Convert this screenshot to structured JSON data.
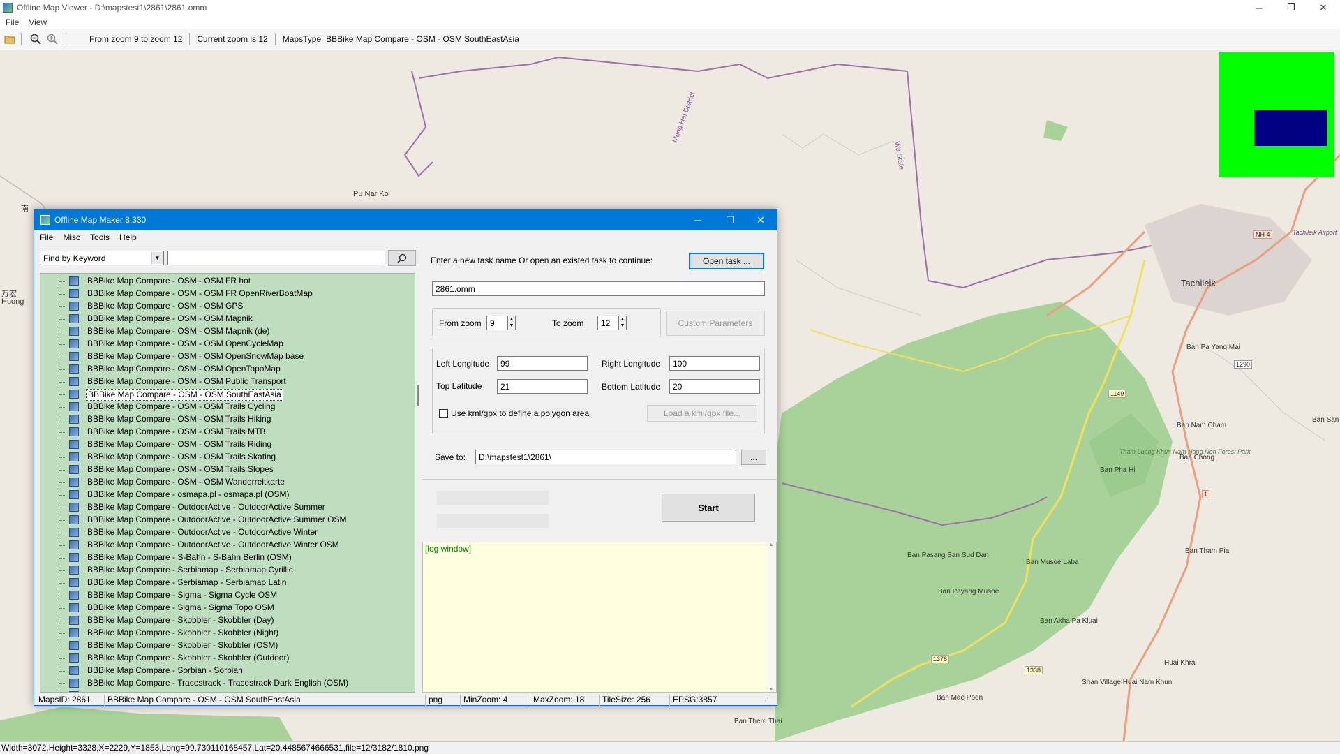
{
  "window": {
    "title": "Offline Map Viewer - D:\\mapstest1\\2861\\2861.omm",
    "controls": [
      "─",
      "❐",
      "✕"
    ]
  },
  "menubar": [
    "File",
    "View"
  ],
  "toolbar": {
    "zoom_range": "From zoom 9 to zoom 12",
    "current_zoom": "Current zoom is 12",
    "maps_type": "MapsType=BBBike Map Compare - OSM - OSM SouthEastAsia"
  },
  "map": {
    "labels": [
      "Pu Nar Ko",
      "南",
      "万宏",
      "Huong",
      "Tachileik",
      "Ban Pa Yang Mai",
      "Ban Nam Cham",
      "Ban San",
      "Ban Pha Hi",
      "Ban Chong",
      "Ban Pasang San Sud Dan",
      "Ban Musoe Laba",
      "Ban Tham Pia",
      "Ban Payang Musoe",
      "Ban Akha Pa Kluai",
      "Ban Mae Poen",
      "Huai Khrai",
      "Shan Village Huai Nam Khun",
      "Ban Therd Thai",
      "Mong Hai District",
      "Wa State",
      "Tham Luang Khun Nam Nang Non Forest Park",
      "Tachileik Airport",
      "NH 4",
      "1290",
      "1149",
      "1378",
      "1338",
      "1"
    ]
  },
  "statusbar": "Width=3072,Height=3328,X=2229,Y=1853,Long=99.730110168457,Lat=20.4485674666531,file=12/3182/1810.png",
  "dialog": {
    "title": "Offline Map Maker 8.330",
    "menu": [
      "File",
      "Misc",
      "Tools",
      "Help"
    ],
    "search": {
      "mode": "Find by Keyword",
      "keyword": ""
    },
    "tree_items": [
      "BBBike Map Compare - OSM - OSM FR hot",
      "BBBike Map Compare - OSM - OSM FR OpenRiverBoatMap",
      "BBBike Map Compare - OSM - OSM GPS",
      "BBBike Map Compare - OSM - OSM Mapnik",
      "BBBike Map Compare - OSM - OSM Mapnik (de)",
      "BBBike Map Compare - OSM - OSM OpenCycleMap",
      "BBBike Map Compare - OSM - OSM OpenSnowMap base",
      "BBBike Map Compare - OSM - OSM OpenTopoMap",
      "BBBike Map Compare - OSM - OSM Public Transport",
      "BBBike Map Compare - OSM - OSM SouthEastAsia",
      "BBBike Map Compare - OSM - OSM Trails Cycling",
      "BBBike Map Compare - OSM - OSM Trails Hiking",
      "BBBike Map Compare - OSM - OSM Trails MTB",
      "BBBike Map Compare - OSM - OSM Trails Riding",
      "BBBike Map Compare - OSM - OSM Trails Skating",
      "BBBike Map Compare - OSM - OSM Trails Slopes",
      "BBBike Map Compare - OSM - OSM Wanderreitkarte",
      "BBBike Map Compare - osmapa.pl - osmapa.pl (OSM)",
      "BBBike Map Compare - OutdoorActive - OutdoorActive Summer",
      "BBBike Map Compare - OutdoorActive - OutdoorActive Summer OSM",
      "BBBike Map Compare - OutdoorActive - OutdoorActive Winter",
      "BBBike Map Compare - OutdoorActive - OutdoorActive Winter OSM",
      "BBBike Map Compare - S-Bahn - S-Bahn Berlin (OSM)",
      "BBBike Map Compare - Serbiamap - Serbiamap Cyrillic",
      "BBBike Map Compare - Serbiamap - Serbiamap Latin",
      "BBBike Map Compare - Sigma - Sigma Cycle OSM",
      "BBBike Map Compare - Sigma - Sigma Topo OSM",
      "BBBike Map Compare - Skobbler - Skobbler (Day)",
      "BBBike Map Compare - Skobbler - Skobbler (Night)",
      "BBBike Map Compare - Skobbler - Skobbler (OSM)",
      "BBBike Map Compare - Skobbler - Skobbler (Outdoor)",
      "BBBike Map Compare - Sorbian - Sorbian",
      "BBBike Map Compare - Tracestrack - Tracestrack Dark English (OSM)",
      "BBBike Map Compare - Tracestrack - Tracestrack default lang (OSM)"
    ],
    "selected_index": 9,
    "task": {
      "prompt": "Enter a new task name Or open an existed task to continue:",
      "open_label": "Open task ...",
      "name": "2861.omm"
    },
    "zoom": {
      "from_label": "From zoom",
      "from_value": "9",
      "to_label": "To zoom",
      "to_value": "12",
      "custom_label": "Custom Parameters"
    },
    "bounds": {
      "left_label": "Left Longitude",
      "left_value": "99",
      "right_label": "Right Longitude",
      "right_value": "100",
      "top_label": "Top Latitude",
      "top_value": "21",
      "bottom_label": "Bottom Latitude",
      "bottom_value": "20",
      "kml_label": "Use kml/gpx to define a polygon area",
      "kml_checked": false,
      "load_label": "Load a kml/gpx file..."
    },
    "save": {
      "label": "Save to:",
      "path": "D:\\mapstest1\\2861\\",
      "browse_label": "..."
    },
    "start_label": "Start",
    "log_text": "[log window]",
    "status": {
      "maps_id": "MapsID: 2861",
      "map_name": "BBBike Map Compare - OSM - OSM SouthEastAsia",
      "format": "png",
      "min_zoom": "MinZoom: 4",
      "max_zoom": "MaxZoom: 18",
      "tile_size": "TileSize: 256",
      "epsg": "EPSG:3857"
    }
  },
  "colors": {
    "dialog_title": "#0078d7",
    "tree_bg": "#bfddbf",
    "log_bg": "#ffffe0",
    "forest": "#a8d29a",
    "overview_bg": "#00ff00",
    "overview_viewport": "#000080",
    "road_main": "#e8a080",
    "road_yellow": "#f0e060",
    "border_purple": "#9e6fa8"
  }
}
